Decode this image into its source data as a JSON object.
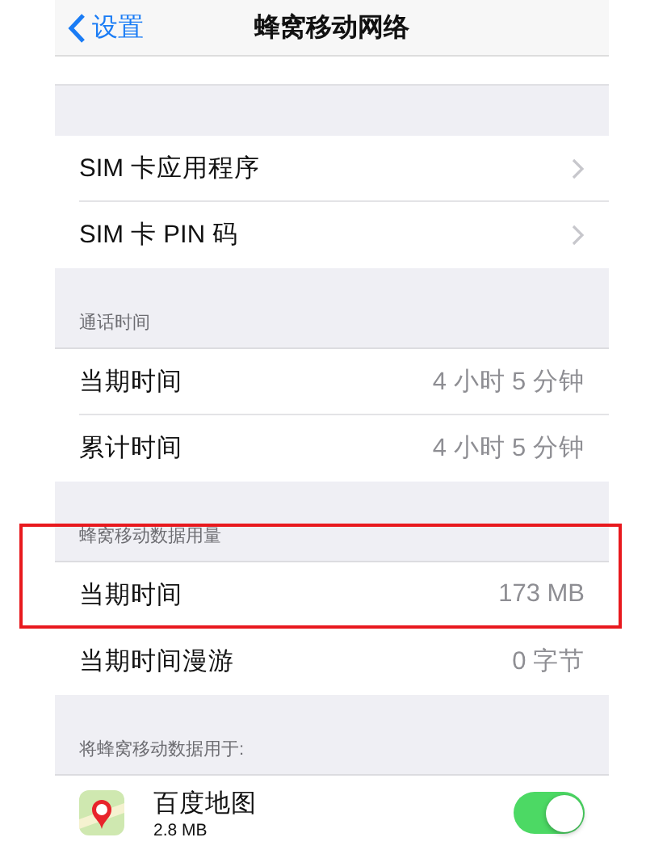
{
  "nav": {
    "back": "设置",
    "title": "蜂窝移动网络"
  },
  "sections": [
    {
      "rows": [
        {
          "kind": "link",
          "label": "SIM 卡应用程序"
        },
        {
          "kind": "link",
          "label": "SIM 卡 PIN 码"
        }
      ]
    },
    {
      "header": "通话时间",
      "rows": [
        {
          "kind": "value",
          "label": "当期时间",
          "value": "4 小时 5 分钟"
        },
        {
          "kind": "value",
          "label": "累计时间",
          "value": "4 小时 5 分钟"
        }
      ]
    },
    {
      "header": "蜂窝移动数据用量",
      "highlighted": true,
      "rows": [
        {
          "kind": "value",
          "label": "当期时间",
          "value": "173 MB"
        },
        {
          "kind": "value",
          "label": "当期时间漫游",
          "value": "0 字节"
        }
      ]
    },
    {
      "header": "将蜂窝移动数据用于:",
      "rows": [
        {
          "kind": "app",
          "label": "百度地图",
          "detail": "2.8 MB",
          "on": true
        }
      ]
    }
  ]
}
